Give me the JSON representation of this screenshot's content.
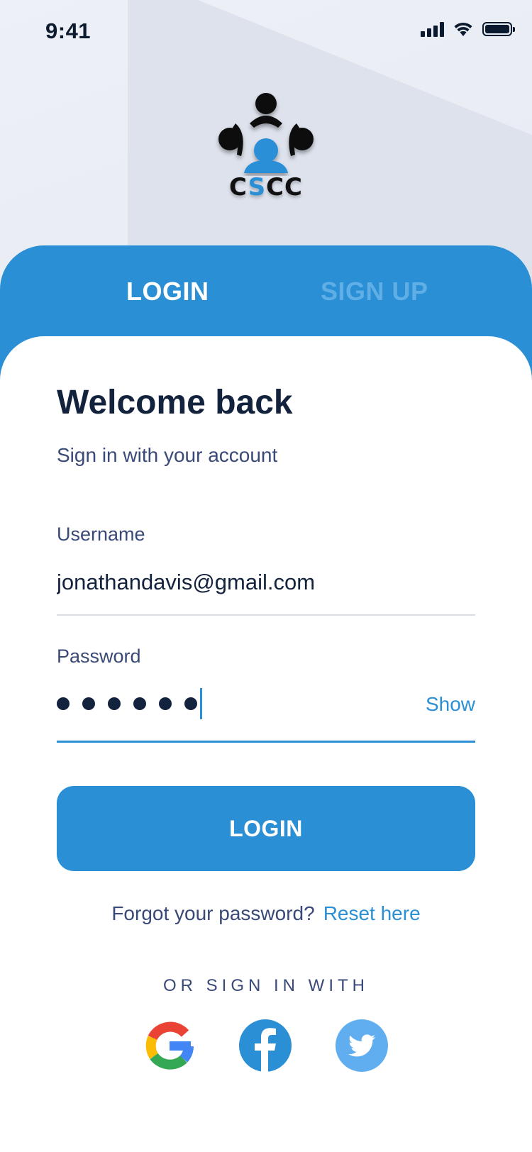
{
  "status_bar": {
    "time": "9:41"
  },
  "logo": {
    "text_prefix": "C",
    "text_accent": "S",
    "text_suffix": "CC"
  },
  "tabs": [
    {
      "label": "LOGIN",
      "active": true
    },
    {
      "label": "SIGN UP",
      "active": false
    }
  ],
  "form": {
    "title": "Welcome back",
    "subtitle": "Sign in with your account",
    "username_label": "Username",
    "username_value": "jonathandavis@gmail.com",
    "password_label": "Password",
    "password_length": 6,
    "show_label": "Show",
    "submit_label": "LOGIN"
  },
  "forgot": {
    "question": "Forgot your password?",
    "link": "Reset here"
  },
  "social": {
    "heading": "OR SIGN IN WITH",
    "providers": [
      {
        "name": "google",
        "icon": "google-icon"
      },
      {
        "name": "facebook",
        "icon": "facebook-icon"
      },
      {
        "name": "twitter",
        "icon": "twitter-icon"
      }
    ]
  },
  "colors": {
    "primary": "#2b8fd6",
    "inactive_tab": "#5faee6",
    "heading": "#13233d",
    "body_text": "#3a4a78",
    "twitter": "#60aef0"
  }
}
